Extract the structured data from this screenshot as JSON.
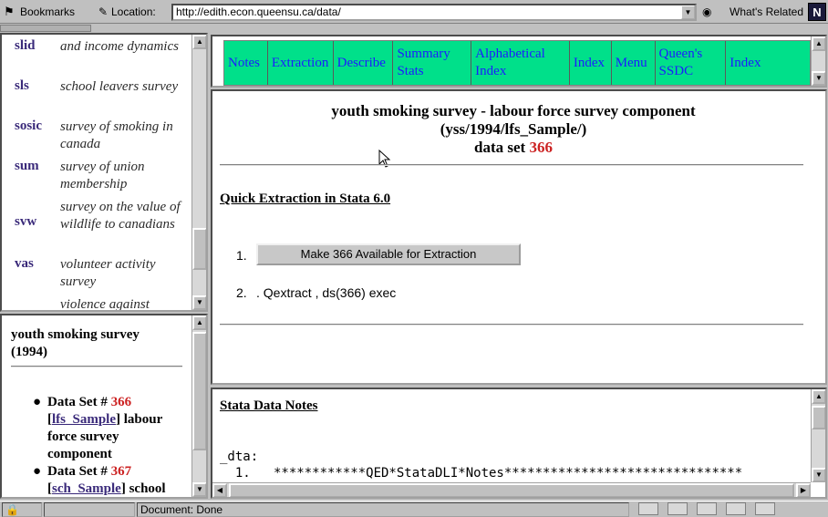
{
  "toolbar": {
    "bookmarks_label": "Bookmarks",
    "location_label": "Location:",
    "location_url": "http://edith.econ.queensu.ca/data/",
    "whats_related_label": "What's Related",
    "netscape_logo": "N"
  },
  "index_list": {
    "items": [
      {
        "code": "slid",
        "desc": "and income dynamics"
      },
      {
        "code": "sls",
        "desc": "school leavers survey"
      },
      {
        "code": "sosic",
        "desc": "survey of smoking in canada"
      },
      {
        "code": "sum",
        "desc": "survey of union membership"
      },
      {
        "code": "svw",
        "desc": "survey on the value of wildlife to canadians"
      },
      {
        "code": "vas",
        "desc": "volunteer activity survey"
      },
      {
        "code": "",
        "desc": "violence against"
      }
    ]
  },
  "survey_panel": {
    "title": "youth smoking survey (1994)",
    "datasets": [
      {
        "prefix": "Data Set # ",
        "number": "366",
        "sample": "lfs_Sample",
        "desc": " labour force survey component"
      },
      {
        "prefix": "Data Set # ",
        "number": "367",
        "sample": "sch_Sample",
        "desc": " school"
      }
    ]
  },
  "nav": {
    "items": [
      "Notes",
      "Extraction",
      "Describe",
      "Summary Stats",
      "Alphabetical Index",
      "Index",
      "Menu",
      "Queen's SSDC",
      "Index"
    ]
  },
  "main": {
    "title_line1": "youth smoking survey - labour force survey component",
    "title_line2": "(yss/1994/lfs_Sample/)",
    "title_line3_prefix": "data set ",
    "title_line3_number": "366",
    "section_title": "Quick Extraction in Stata 6.0",
    "item1_num": "1.",
    "extract_button_label": "Make 366 Available for Extraction",
    "item2_num": "2.",
    "command_text": ". Qextract , ds(366) exec"
  },
  "notes": {
    "title": "Stata Data Notes",
    "line1": "_dta:",
    "line2": "  1.   ************QED*StataDLI*Notes*******************************"
  },
  "status": {
    "text": "Document: Done"
  }
}
